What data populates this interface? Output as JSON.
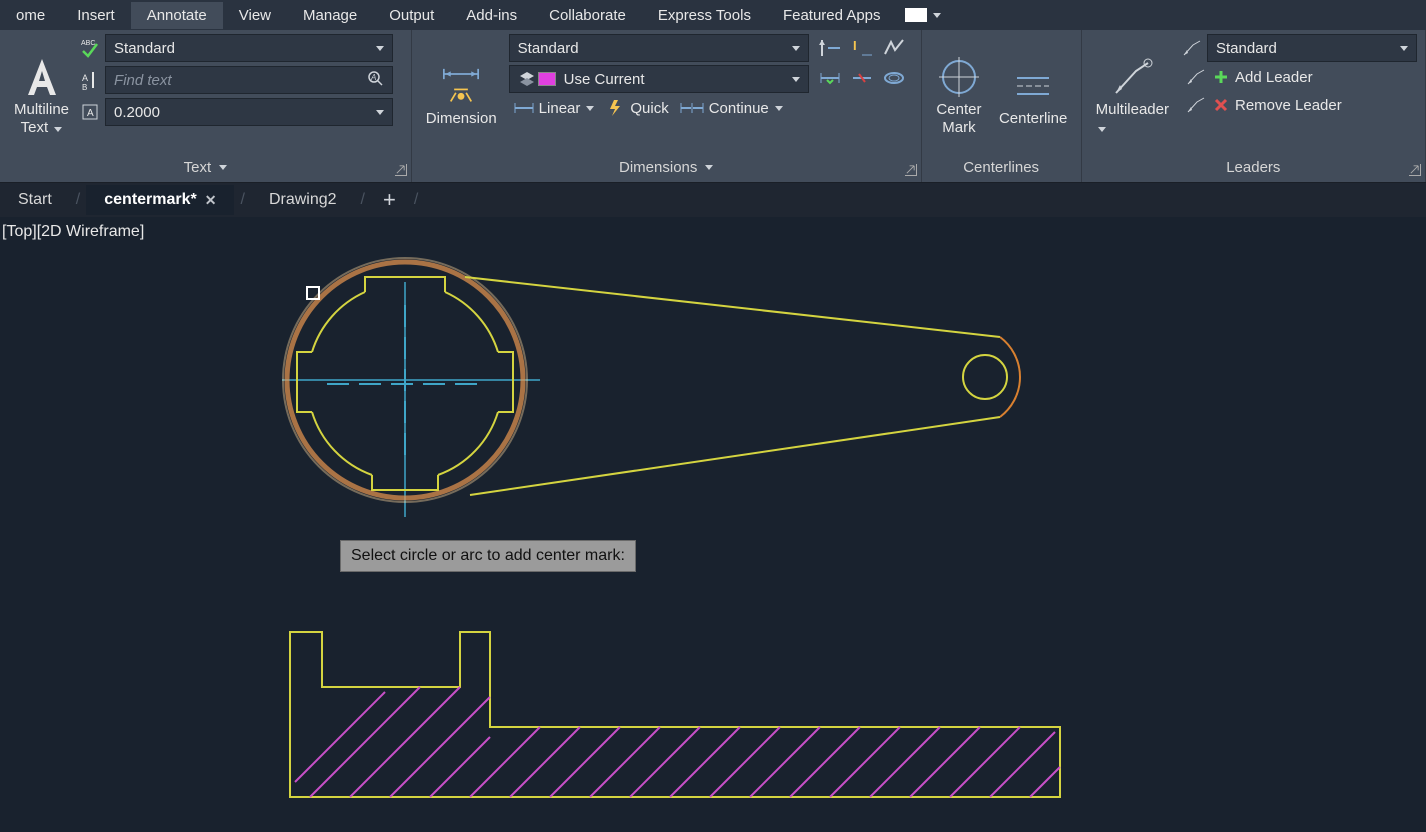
{
  "menu": {
    "items": [
      "ome",
      "Insert",
      "Annotate",
      "View",
      "Manage",
      "Output",
      "Add-ins",
      "Collaborate",
      "Express Tools",
      "Featured Apps"
    ],
    "active_index": 2
  },
  "ribbon": {
    "text": {
      "title": "Text",
      "big_label": "Multiline\nText",
      "style_combo": "Standard",
      "find_placeholder": "Find text",
      "height_combo": "0.2000"
    },
    "dimensions": {
      "title": "Dimensions",
      "big_label": "Dimension",
      "style_combo": "Standard",
      "layer_combo": "Use Current",
      "linear": "Linear",
      "quick": "Quick",
      "continue": "Continue"
    },
    "centerlines": {
      "title": "Centerlines",
      "center_mark": "Center\nMark",
      "centerline": "Centerline"
    },
    "leaders": {
      "title": "Leaders",
      "big_label": "Multileader",
      "style_combo": "Standard",
      "add": "Add Leader",
      "remove": "Remove Leader"
    }
  },
  "tabs": {
    "items": [
      "Start",
      "centermark*",
      "Drawing2"
    ],
    "active_index": 1
  },
  "canvas": {
    "view_label": "[Top][2D Wireframe]",
    "tooltip": "Select circle or arc to add center mark:"
  }
}
